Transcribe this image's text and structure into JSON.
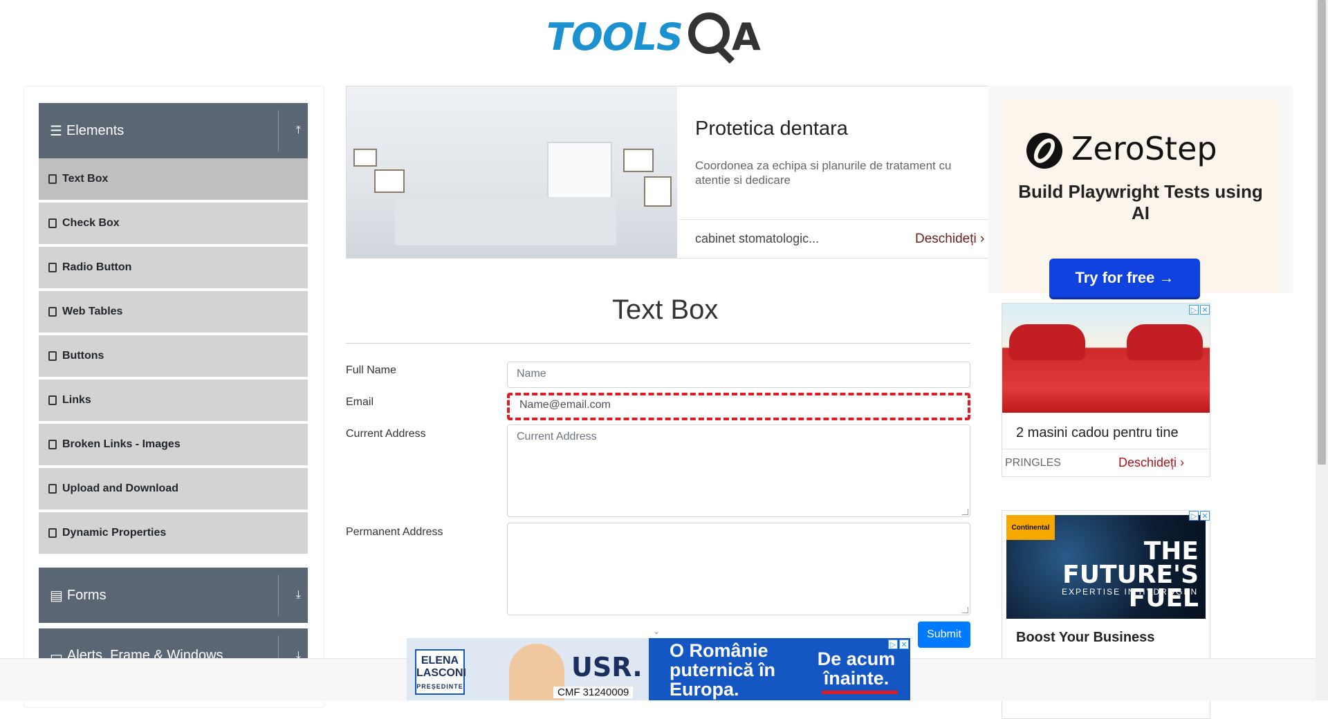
{
  "logo": {
    "text": "TOOLS",
    "qa": "A"
  },
  "sidebar": {
    "elements_group": "Elements",
    "items": [
      {
        "label": "Text Box"
      },
      {
        "label": "Check Box"
      },
      {
        "label": "Radio Button"
      },
      {
        "label": "Web Tables"
      },
      {
        "label": "Buttons"
      },
      {
        "label": "Links"
      },
      {
        "label": "Broken Links - Images"
      },
      {
        "label": "Upload and Download"
      },
      {
        "label": "Dynamic Properties"
      }
    ],
    "forms_group": "Forms",
    "alerts_group": "Alerts, Frame & Windows"
  },
  "top_ad": {
    "title": "Protetica dentara",
    "description": "Coordonea za echipa si planurile de tratament cu atentie si dedicare",
    "footer": "cabinet stomatologic...",
    "cta": "Deschideți"
  },
  "main": {
    "title": "Text Box",
    "form": {
      "full_name_label": "Full Name",
      "full_name_placeholder": "Name",
      "email_label": "Email",
      "email_placeholder": "Name@email.com",
      "current_address_label": "Current Address",
      "current_address_placeholder": "Current Address",
      "permanent_address_label": "Permanent Address",
      "submit_label": "Submit"
    }
  },
  "right_ads": {
    "zerostep": {
      "name": "ZeroStep",
      "tagline": "Build Playwright Tests using AI",
      "cta": "Try for free →"
    },
    "car": {
      "title": "2 masini cadou pentru tine",
      "brand": "PRINGLES",
      "cta": "Deschideți"
    },
    "fuel": {
      "badge": "Continental",
      "headline": "THE FUTURE'S FUEL",
      "sub": "EXPERTISE IN HYDROGEN",
      "title": "Boost Your Business"
    }
  },
  "bottom_banner": {
    "name": "ELENA LASCONI",
    "role": "PREȘEDINTE",
    "party": "USR.",
    "code": "CMF 31240009",
    "slogan": "O Românie puternică în Europa.",
    "cta": "De acum înainte."
  }
}
